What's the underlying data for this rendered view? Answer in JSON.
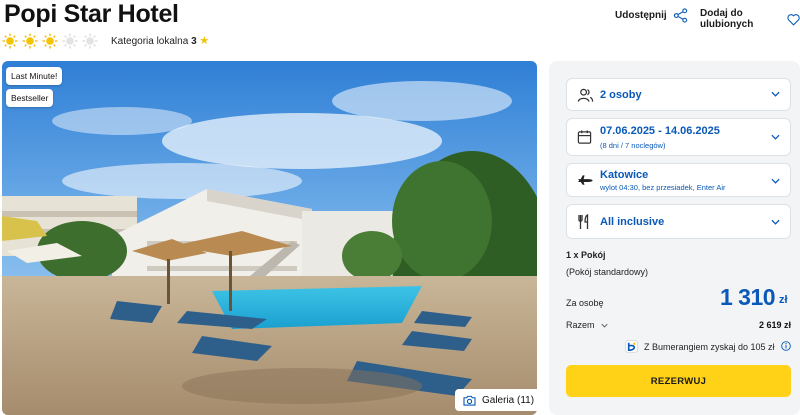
{
  "hotel": {
    "name": "Popi Star Hotel",
    "stars": 3,
    "stars_max": 5,
    "category_label": "Kategoria lokalna",
    "category_value": "3"
  },
  "actions": {
    "share": "Udostępnij",
    "favorite": "Dodaj do ulubionych"
  },
  "photo": {
    "badges": [
      "Last Minute!",
      "Bestseller"
    ],
    "gallery": "Galeria (11)"
  },
  "booking": {
    "people": "2 osoby",
    "dates": "07.06.2025 - 14.06.2025",
    "duration": "(8 dni / 7 noclegów)",
    "departure_city": "Katowice",
    "flight_info": "wylot 04:30, bez przesiadek, Enter Air",
    "board": "All inclusive",
    "room_count": "1 x Pokój",
    "room_type": "(Pokój standardowy)",
    "per_person_label": "Za osobę",
    "per_person_price": "1 310",
    "currency": "zł",
    "total_label": "Razem",
    "total_price": "2 619 zł",
    "bumerang": "Z Bumerangiem zyskaj do 105 zł",
    "reserve_button": "REZERWUJ"
  },
  "colors": {
    "accent_blue": "#0a59b8",
    "button_yellow": "#ffd217",
    "star_yellow": "#f5c400",
    "panel_bg": "#f3f4f6"
  }
}
